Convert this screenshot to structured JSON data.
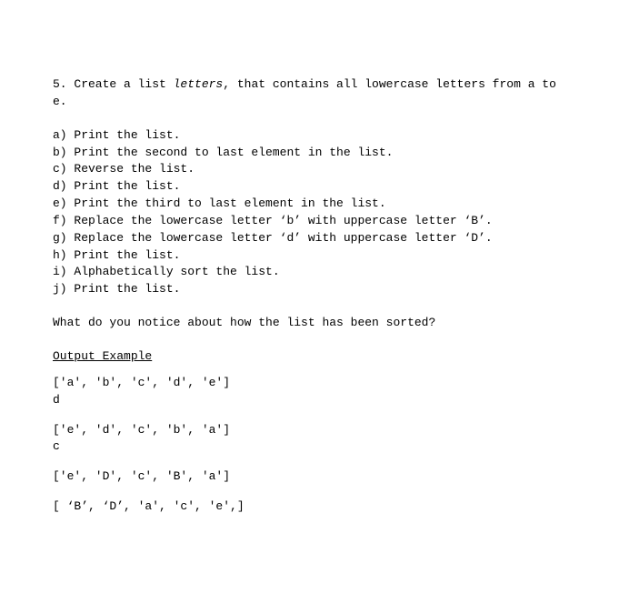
{
  "intro": {
    "prefix": "5. Create a list ",
    "varname": "letters",
    "suffix": ", that contains all lowercase letters from a to e."
  },
  "steps": [
    "a) Print the list.",
    "b) Print the second to last element in the list.",
    "c) Reverse the list.",
    "d) Print the list.",
    "e) Print the third to last element in the list.",
    "f) Replace the lowercase letter ‘b’ with uppercase letter ‘B’.",
    "g) Replace the lowercase letter ‘d’ with uppercase letter ‘D’.",
    "h) Print the list.",
    "i) Alphabetically sort the list.",
    "j) Print the list."
  ],
  "question": "What do you notice about how the list has been sorted?",
  "output_heading": "Output Example",
  "outputs": [
    "['a', 'b', 'c', 'd', 'e']\nd",
    "['e', 'd', 'c', 'b', 'a']\nc",
    "['e', 'D', 'c', 'B', 'a']",
    "[ ‘B’, ‘D’, 'a', 'c', 'e',]"
  ]
}
